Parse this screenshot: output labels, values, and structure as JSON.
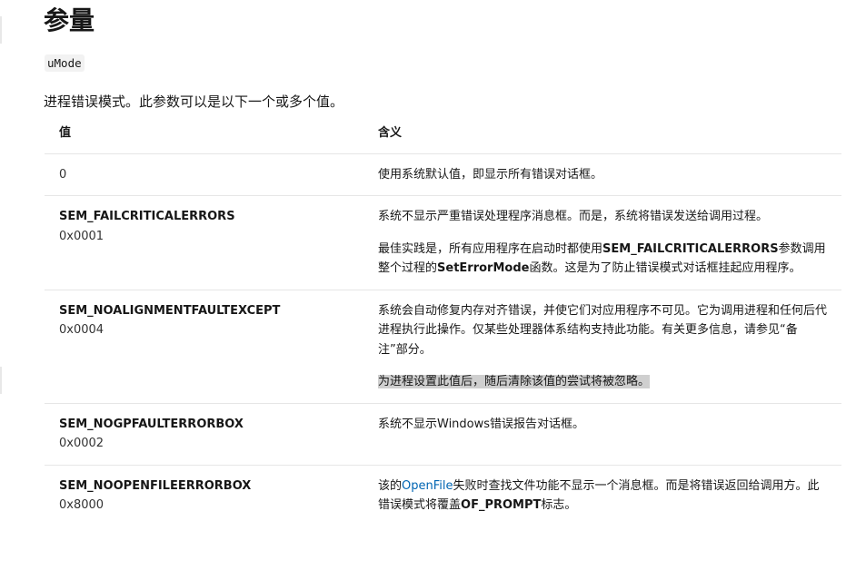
{
  "heading": "参量",
  "param_name": "uMode",
  "description": "进程错误模式。此参数可以是以下一个或多个值。",
  "table": {
    "headers": [
      "值",
      "含义"
    ],
    "rows": [
      {
        "name": "0",
        "code": "",
        "meaning_1": "使用系统默认值，即显示所有错误对话框。"
      },
      {
        "name": "SEM_FAILCRITICALERRORS",
        "code": "0x0001",
        "meaning_1": "系统不显示严重错误处理程序消息框。而是，系统将错误发送给调用过程。",
        "meaning_2_a": "最佳实践是，所有应用程序在启动时都使用",
        "meaning_2_b": "SEM_FAILCRITICALERRORS",
        "meaning_2_c": "参数调用整个过程的",
        "meaning_2_d": "SetErrorMode",
        "meaning_2_e": "函数。这是为了防止错误模式对话框挂起应用程序。"
      },
      {
        "name": "SEM_NOALIGNMENTFAULTEXCEPT",
        "code": "0x0004",
        "meaning_1": "系统会自动修复内存对齐错误，并使它们对应用程序不可见。它为调用进程和任何后代进程执行此操作。仅某些处理器体系结构支持此功能。有关更多信息，请参见“备注”部分。",
        "meaning_2": "为进程设置此值后，随后清除该值的尝试将被忽略。"
      },
      {
        "name": "SEM_NOGPFAULTERRORBOX",
        "code": "0x0002",
        "meaning_1": "系统不显示Windows错误报告对话框。"
      },
      {
        "name": "SEM_NOOPENFILEERRORBOX",
        "code": "0x8000",
        "meaning_a": "该的",
        "meaning_link": "OpenFile",
        "meaning_b": "失败时查找文件功能不显示一个消息框。而是将错误返回给调用方。此错误模式将覆盖",
        "meaning_c": "OF_PROMPT",
        "meaning_d": "标志。"
      }
    ]
  },
  "colors": {
    "link": "#0065b3",
    "highlight": "#cfcfcf",
    "border": "#e6e6e6"
  }
}
